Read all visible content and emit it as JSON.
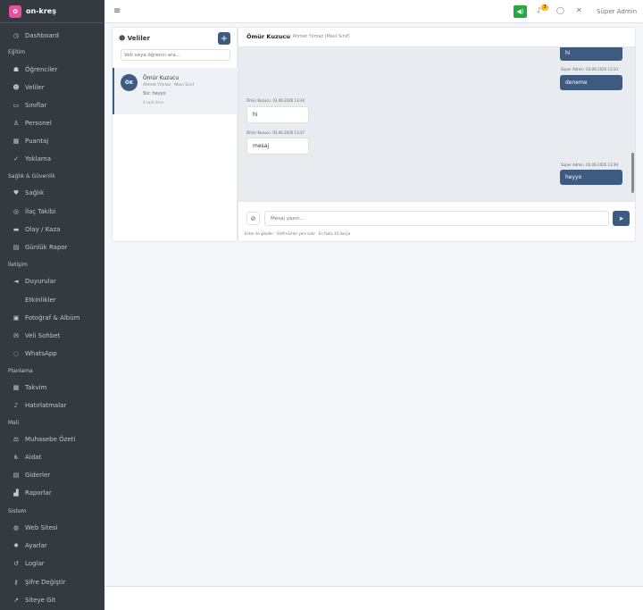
{
  "brand": {
    "name": "on-kreş",
    "logo_glyph": "✿"
  },
  "sidebar": {
    "dashboard": "Dashboard",
    "headers": {
      "egitim": "Eğitim",
      "saglik": "Sağlık & Güvenlik",
      "iletisim": "İletişim",
      "planlama": "Planlama",
      "mali": "Mali",
      "sistem": "Sistem"
    },
    "items": [
      {
        "label": "Dashboard",
        "icon": "◷"
      },
      {
        "label": "Öğrenciler",
        "icon": "☗"
      },
      {
        "label": "Veliler",
        "icon": "☻"
      },
      {
        "label": "Sınıflar",
        "icon": "▭"
      },
      {
        "label": "Personel",
        "icon": "♙"
      },
      {
        "label": "Puantaj",
        "icon": "▦"
      },
      {
        "label": "Yoklama",
        "icon": "✓"
      },
      {
        "label": "Sağlık",
        "icon": "♥"
      },
      {
        "label": "İlaç Takibi",
        "icon": "◎"
      },
      {
        "label": "Olay / Kaza",
        "icon": "▬"
      },
      {
        "label": "Günlük Rapor",
        "icon": "▤"
      },
      {
        "label": "Duyurular",
        "icon": "◄"
      },
      {
        "label": "Etkinlikler",
        "icon": ""
      },
      {
        "label": "Fotoğraf & Albüm",
        "icon": "▣"
      },
      {
        "label": "Veli Sohbet",
        "icon": "✉"
      },
      {
        "label": "WhatsApp",
        "icon": "◌"
      },
      {
        "label": "Takvim",
        "icon": "▦"
      },
      {
        "label": "Hatırlatmalar",
        "icon": "♪"
      },
      {
        "label": "Muhasebe Özeti",
        "icon": "⚖"
      },
      {
        "label": "Aidat",
        "icon": "₺"
      },
      {
        "label": "Giderler",
        "icon": "▤"
      },
      {
        "label": "Raporlar",
        "icon": "▟"
      },
      {
        "label": "Web Sitesi",
        "icon": "◍"
      },
      {
        "label": "Ayarlar",
        "icon": "✹"
      },
      {
        "label": "Loglar",
        "icon": "↺"
      },
      {
        "label": "Şifre Değiştir",
        "icon": "⚷"
      },
      {
        "label": "Siteye Git",
        "icon": "↗"
      }
    ]
  },
  "topbar": {
    "menu_icon": "≡",
    "sound_icon": "◀)",
    "bell_icon": "♪",
    "bell_count": "3",
    "chat_icon": "◯",
    "expand_icon": "✕",
    "user": "Süper Admin"
  },
  "contacts": {
    "title": "Veliler",
    "title_icon": "☻",
    "add_icon": "+",
    "search_placeholder": "Veli veya öğrenci ara...",
    "items": [
      {
        "initials": "ÖK",
        "name": "Ömür Kuzucu",
        "sub": "Ahmet Yılmaz · Mavi Sınıf",
        "last": "Siz: heyyo",
        "time": "4 saat önce"
      }
    ]
  },
  "chat": {
    "title": "Ömür Kuzucu",
    "subtitle": "— Ahmet Yılmaz (Mavi Sınıf)",
    "messages": [
      {
        "dir": "out",
        "sender": "",
        "time": "",
        "text": "hi"
      },
      {
        "dir": "out",
        "sender": "Süper Admin",
        "time": "03.06.2026 13:33",
        "text": "deneme"
      },
      {
        "dir": "in",
        "sender": "Ömür Kuzucu",
        "time": "03.06.2026 13:34",
        "text": "hi"
      },
      {
        "dir": "in",
        "sender": "Ömür Kuzucu",
        "time": "03.06.2026 13:37",
        "text": "mesaj"
      },
      {
        "dir": "out",
        "sender": "Süper Admin",
        "time": "03.06.2026 13:39",
        "text": "heyyo"
      }
    ],
    "input_placeholder": "Mesaj yazın...",
    "attach_icon": "⊘",
    "send_icon": "➤",
    "hint": "Enter ile gönder · Shift+Enter yeni satır · En fazla 10 dosya"
  },
  "colors": {
    "sidebar": "#343a40",
    "accent": "#3d5a80",
    "brand": "#e8519a",
    "sound": "#28a745"
  }
}
